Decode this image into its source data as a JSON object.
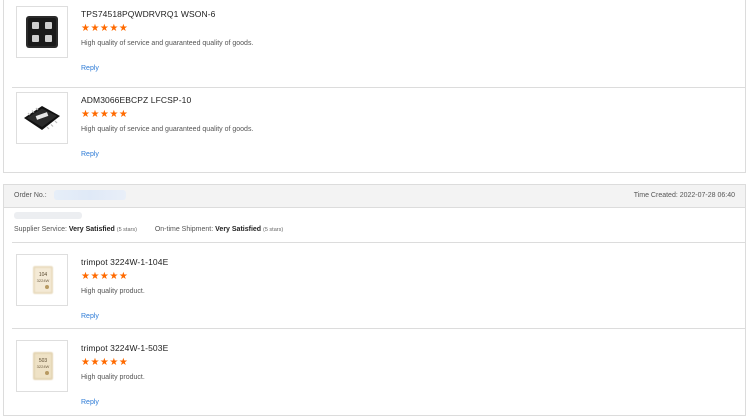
{
  "top_reviews": [
    {
      "product": "TPS74518PQWDRVRQ1 WSON-6",
      "stars": "★★★★★",
      "comment": "High quality of service and guaranteed quality of goods.",
      "reply": "Reply"
    },
    {
      "product": "ADM3066EBCPZ LFCSP-10",
      "stars": "★★★★★",
      "comment": "High quality of service and guaranteed quality of goods.",
      "reply": "Reply"
    }
  ],
  "order": {
    "label": "Order No.:",
    "time_created": "Time Created: 2022-07-28 06:40",
    "supplier_service_label": "Supplier Service:",
    "supplier_service_value": "Very Satisfied",
    "supplier_service_stars": "(5 stars)",
    "shipment_label": "On-time Shipment:",
    "shipment_value": "Very Satisfied",
    "shipment_stars": "(5 stars)",
    "reviews": [
      {
        "product": "trimpot 3224W-1-104E",
        "stars": "★★★★★",
        "comment": "High quality product.",
        "reply": "Reply",
        "chip_text": "104"
      },
      {
        "product": "trimpot 3224W-1-503E",
        "stars": "★★★★★",
        "comment": "High quality product.",
        "reply": "Reply",
        "chip_text": "503"
      }
    ]
  },
  "colors": {
    "star": "#ff6a00",
    "link": "#2d7bd6",
    "header_bg": "#f3f3f3",
    "border": "#dcdcdc"
  }
}
